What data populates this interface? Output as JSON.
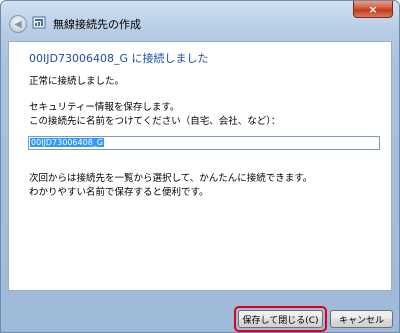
{
  "window": {
    "title": "無線接続先の作成",
    "close_label": "×"
  },
  "content": {
    "heading": "00IJD73006408_G に接続しました",
    "line_success": "正常に接続しました。",
    "line_save_info": "セキュリティー情報を保存します。",
    "line_name_prompt": "この接続先に名前をつけてください（自宅、会社、など）：",
    "name_value": "00IJD73006408_G",
    "line_next_time": "次回からは接続先を一覧から選択して、かんたんに接続できます。",
    "line_tip": "わかりやすい名前で保存すると便利です。"
  },
  "buttons": {
    "save_close": "保存して閉じる(C)",
    "cancel": "キャンセル"
  },
  "colors": {
    "heading": "#1f4fa0",
    "highlight": "#e0001a",
    "selection": "#3399ff"
  }
}
